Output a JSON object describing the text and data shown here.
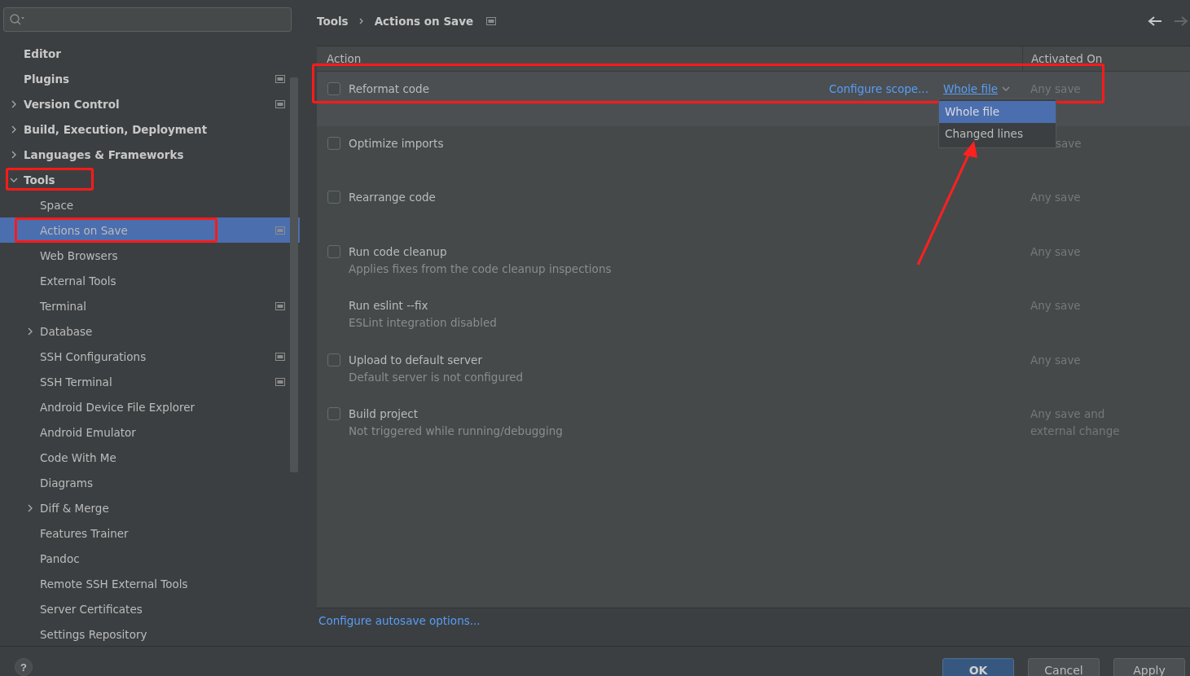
{
  "sidebar": {
    "items": [
      {
        "label": "Editor",
        "bold": true,
        "selected": false
      },
      {
        "label": "Plugins",
        "bold": true,
        "selected": false,
        "project": true
      },
      {
        "label": "Version Control",
        "bold": true,
        "selected": false,
        "project": true,
        "expanded": false
      },
      {
        "label": "Build, Execution, Deployment",
        "bold": true,
        "selected": false,
        "expanded": false
      },
      {
        "label": "Languages & Frameworks",
        "bold": true,
        "selected": false,
        "expanded": false
      },
      {
        "label": "Tools",
        "bold": true,
        "selected": false,
        "outlined": true,
        "expanded": true,
        "children": [
          {
            "label": "Space",
            "bold": false,
            "selected": false
          },
          {
            "label": "Actions on Save",
            "bold": false,
            "selected": true,
            "outlined": true,
            "project": true
          },
          {
            "label": "Web Browsers",
            "bold": false,
            "selected": false
          },
          {
            "label": "External Tools",
            "bold": false,
            "selected": false
          },
          {
            "label": "Terminal",
            "bold": false,
            "selected": false,
            "project": true
          },
          {
            "label": "Database",
            "bold": false,
            "selected": false,
            "expanded": false
          },
          {
            "label": "SSH Configurations",
            "bold": false,
            "selected": false,
            "project": true
          },
          {
            "label": "SSH Terminal",
            "bold": false,
            "selected": false,
            "project": true
          },
          {
            "label": "Android Device File Explorer",
            "bold": false,
            "selected": false
          },
          {
            "label": "Android Emulator",
            "bold": false,
            "selected": false
          },
          {
            "label": "Code With Me",
            "bold": false,
            "selected": false
          },
          {
            "label": "Diagrams",
            "bold": false,
            "selected": false
          },
          {
            "label": "Diff & Merge",
            "bold": false,
            "selected": false,
            "expanded": false
          },
          {
            "label": "Features Trainer",
            "bold": false,
            "selected": false
          },
          {
            "label": "Pandoc",
            "bold": false,
            "selected": false
          },
          {
            "label": "Remote SSH External Tools",
            "bold": false,
            "selected": false
          },
          {
            "label": "Server Certificates",
            "bold": false,
            "selected": false
          },
          {
            "label": "Settings Repository",
            "bold": false,
            "selected": false
          }
        ]
      }
    ]
  },
  "breadcrumb": [
    "Tools",
    "Actions on Save"
  ],
  "table": {
    "columns": [
      "Action",
      "Activated On"
    ],
    "rows": [
      {
        "kind": "checkbox",
        "checked": false,
        "outlined": true,
        "title": "Reformat code",
        "configure_link": "Configure scope...",
        "scope": "Whole file",
        "activated": "Any save",
        "popup": {
          "options": [
            {
              "label": "Whole file",
              "selected": true
            },
            {
              "label": "Changed lines",
              "selected": false
            }
          ],
          "pointer_arrow": true
        }
      },
      {
        "kind": "checkbox",
        "checked": false,
        "title": "Optimize imports",
        "activated": "save",
        "covered": true
      },
      {
        "kind": "checkbox",
        "checked": false,
        "title": "Rearrange code",
        "activated": "Any save"
      },
      {
        "kind": "checkbox",
        "checked": false,
        "title": "Run code cleanup",
        "subtitle": "Applies fixes from the code cleanup inspections",
        "activated": "Any save"
      },
      {
        "kind": "plain",
        "title": "Run eslint --fix",
        "subtitle": "ESLint integration disabled",
        "activated": "Any save"
      },
      {
        "kind": "checkbox",
        "checked": false,
        "title": "Upload to default server",
        "subtitle": "Default server is not configured",
        "activated": "Any save"
      },
      {
        "kind": "checkbox",
        "checked": false,
        "title": "Build project",
        "subtitle": "Not triggered while running/debugging",
        "activated": "Any save and external change"
      }
    ]
  },
  "autosave_link": "Configure autosave options...",
  "help": "?",
  "buttons": [
    {
      "label": "OK",
      "kind": "primary"
    },
    {
      "label": "Cancel",
      "kind": "normal"
    },
    {
      "label": "Apply",
      "kind": "normal"
    }
  ]
}
